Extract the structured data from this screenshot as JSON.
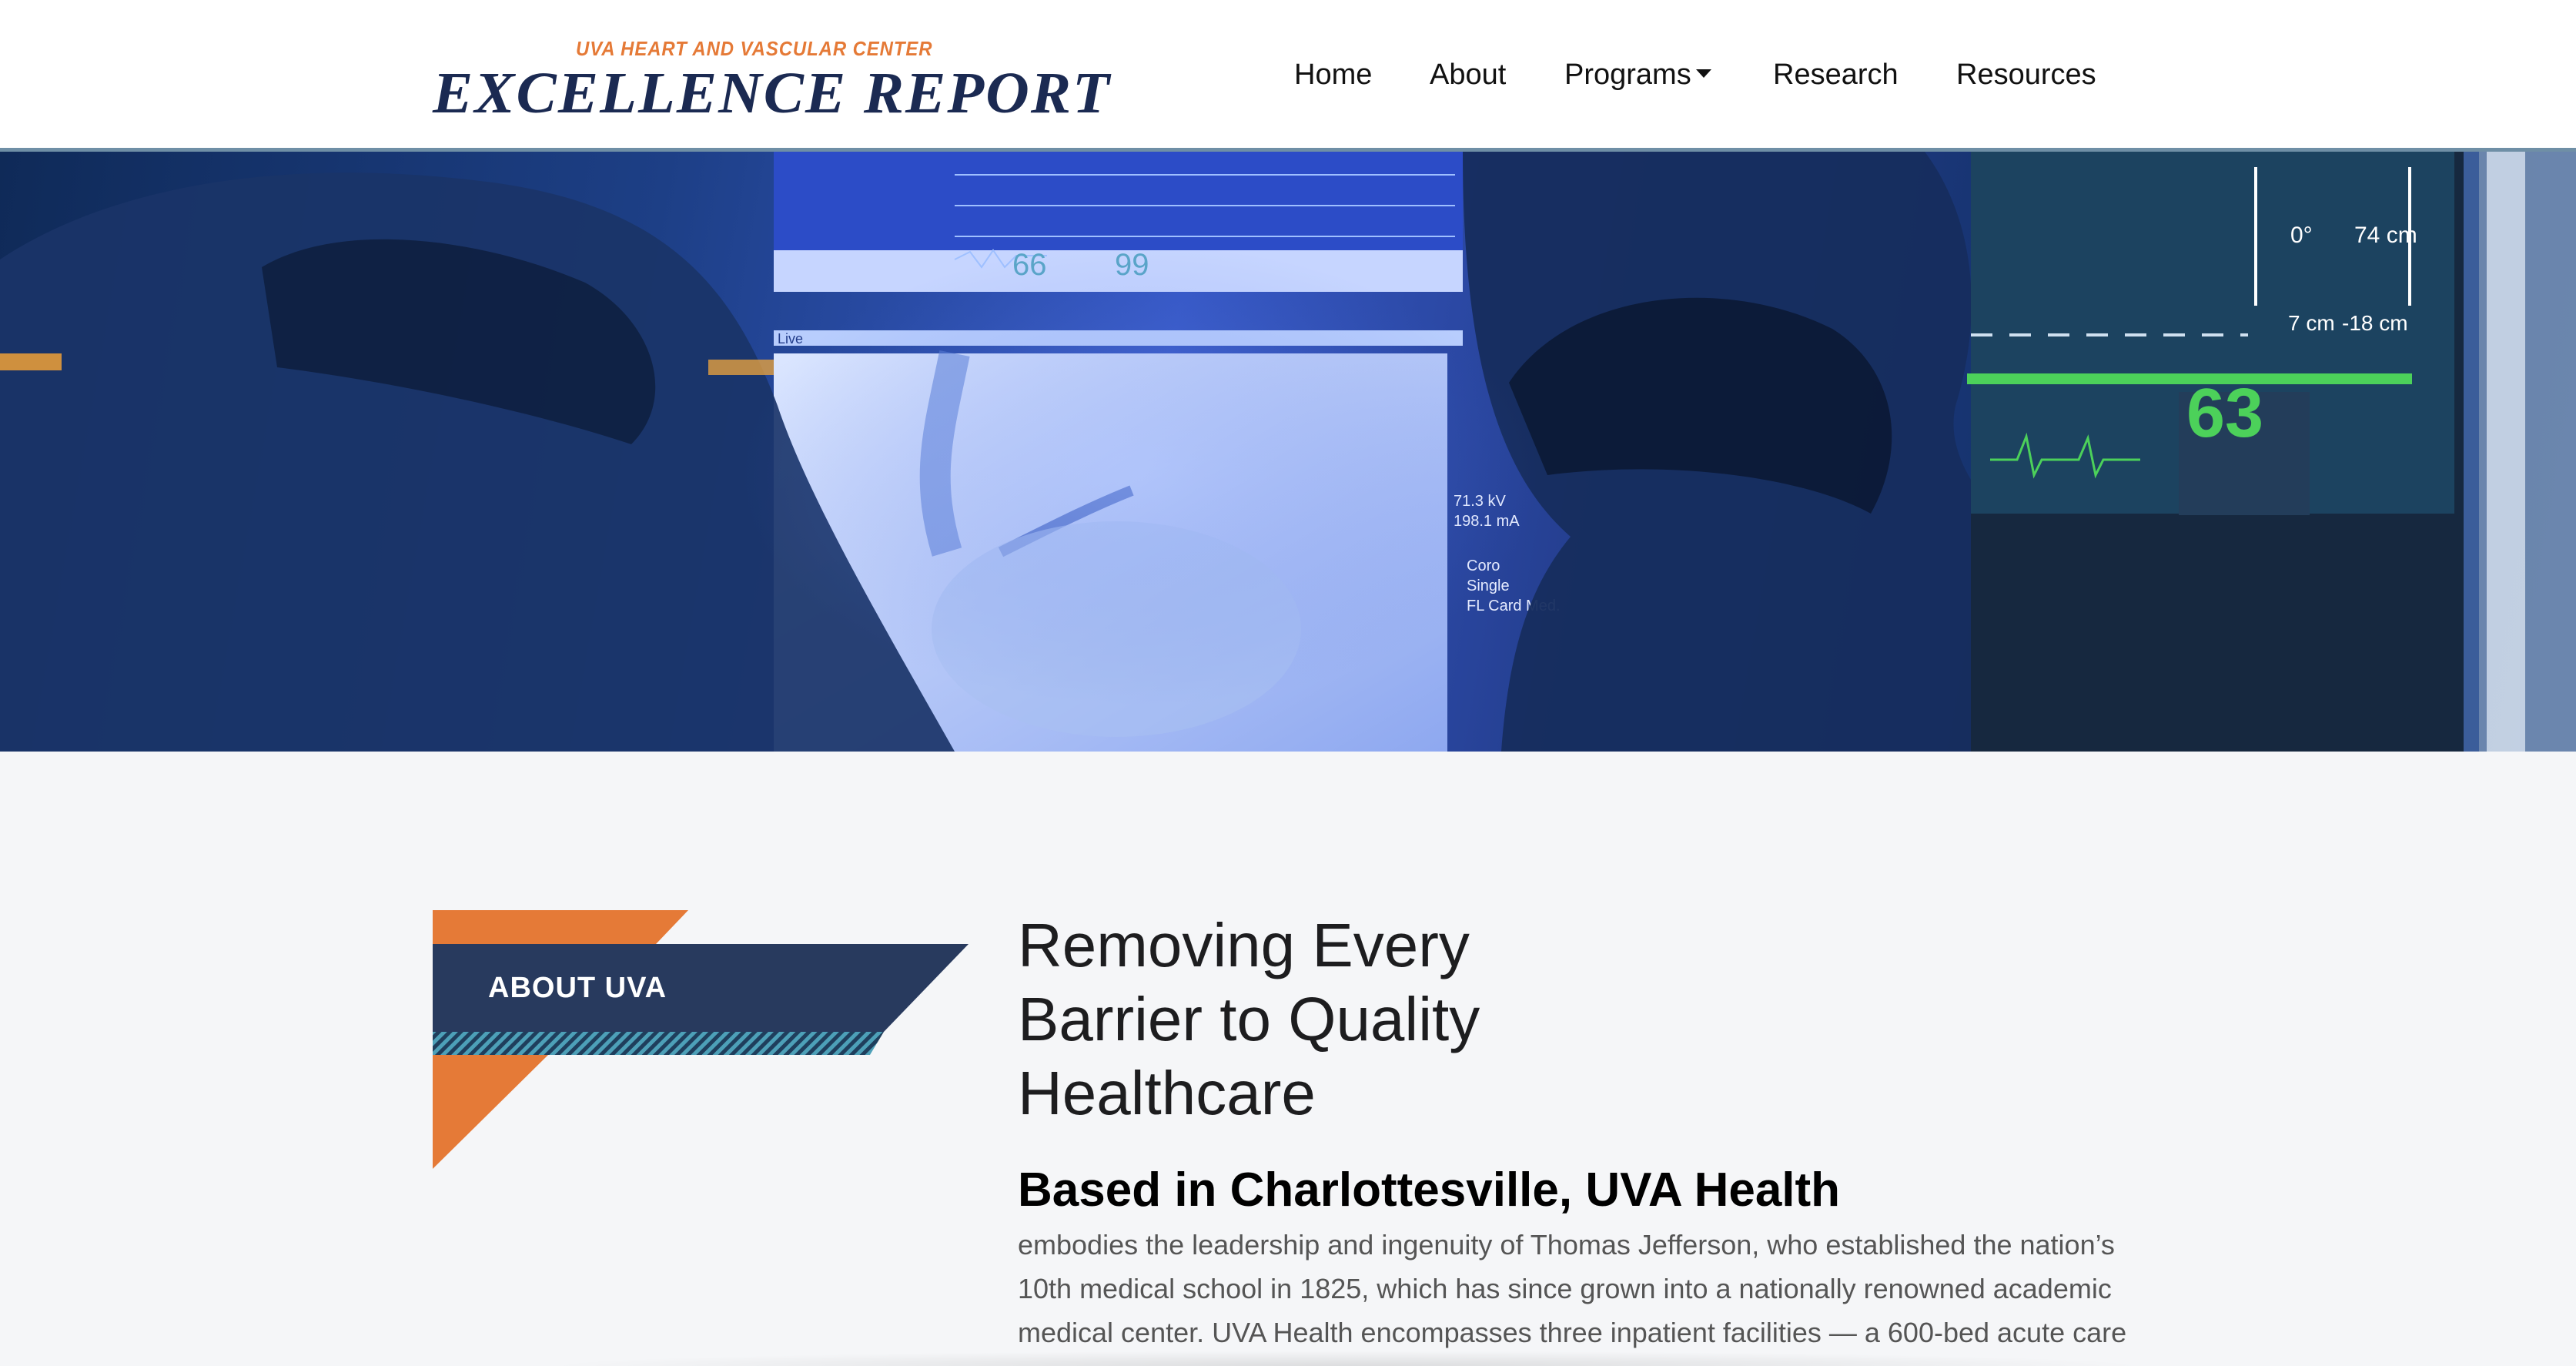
{
  "header": {
    "kicker": "UVA HEART AND VASCULAR CENTER",
    "title": "EXCELLENCE REPORT",
    "nav": [
      {
        "label": "Home"
      },
      {
        "label": "About"
      },
      {
        "label": "Programs"
      },
      {
        "label": "Research"
      },
      {
        "label": "Resources"
      }
    ]
  },
  "hero": {
    "monitor_readouts": [
      "66",
      "99",
      "63",
      "Live",
      "0°",
      "74 cm",
      "7 cm",
      "-18 cm",
      "71.3 kV",
      "198.1 mA",
      "Coro",
      "Single",
      "FL Card Med."
    ]
  },
  "about": {
    "badge_label": "ABOUT UVA",
    "headline": "Removing Every Barrier to Quality Healthcare",
    "subhead": "Based in Charlottesville, UVA Health",
    "body": "embodies the leadership and ingenuity of Thomas Jefferson, who established the nation’s 10th medical school in 1825, which has since grown into a nationally renowned academic medical center. UVA Health encompasses three inpatient facilities — a 600-bed acute care"
  },
  "colors": {
    "navy": "#1b2a52",
    "orange": "#e57a37",
    "badge_navy": "#283a5e",
    "teal_stripe": "#3e8aa0",
    "monitor_green": "#4cd15a"
  }
}
